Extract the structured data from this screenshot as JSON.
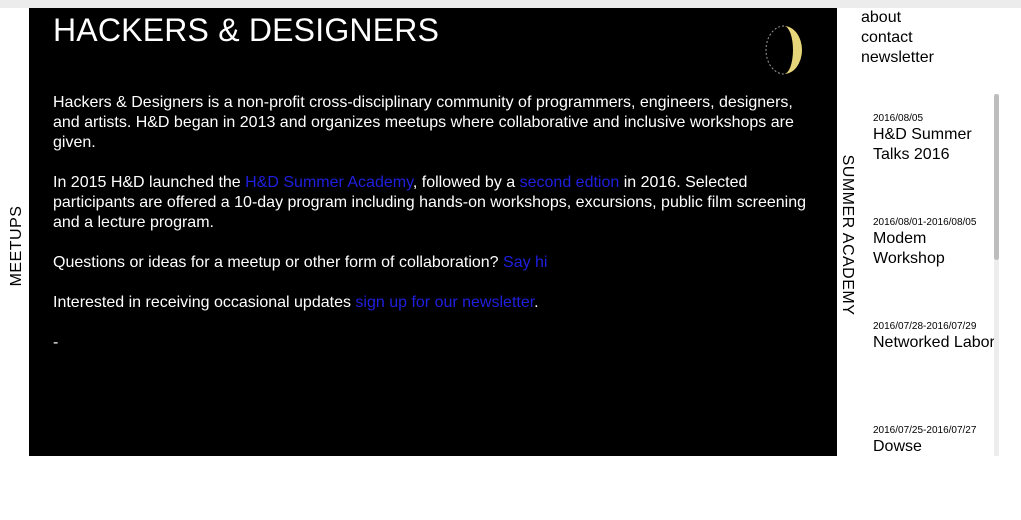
{
  "site": {
    "title": "HACKERS & DESIGNERS"
  },
  "labels": {
    "left": "MEETUPS",
    "right": "SUMMER ACADEMY"
  },
  "intro": {
    "p1": "Hackers & Designers is a non-profit cross-disciplinary community of programmers, engineers, designers, and artists. H&D began in 2013 and organizes meetups where collaborative and inclusive workshops are given.",
    "p2_a": "In 2015 H&D launched the ",
    "p2_link1": "H&D Summer Academy",
    "p2_b": ", followed by a ",
    "p2_link2": "second edtion",
    "p2_c": " in 2016. Selected participants are offered a 10-day program including hands-on workshops, excursions, public film screening and a lecture program.",
    "p3_a": "Questions or ideas for a meetup or other form of collaboration? ",
    "p3_link": "Say hi",
    "p4_a": "Interested in receiving occasional updates ",
    "p4_link": "sign up for our newsletter",
    "p4_b": ".",
    "dash": "-"
  },
  "nav": {
    "about": "about",
    "contact": "contact",
    "newsletter": "newsletter"
  },
  "events": [
    {
      "date": "2016/08/05",
      "title": "H&D Summer Talks 2016"
    },
    {
      "date": "2016/08/01-2016/08/05",
      "title": "Modem Workshop"
    },
    {
      "date": "2016/07/28-2016/07/29",
      "title": "Networked Labor"
    },
    {
      "date": "2016/07/25-2016/07/27",
      "title": "Dowse"
    }
  ],
  "colors": {
    "background": "#000000",
    "text": "#ffffff",
    "link": "#1f1fe0",
    "moon": "#e8d77a"
  },
  "icons": {
    "logo": "moon-icon"
  }
}
